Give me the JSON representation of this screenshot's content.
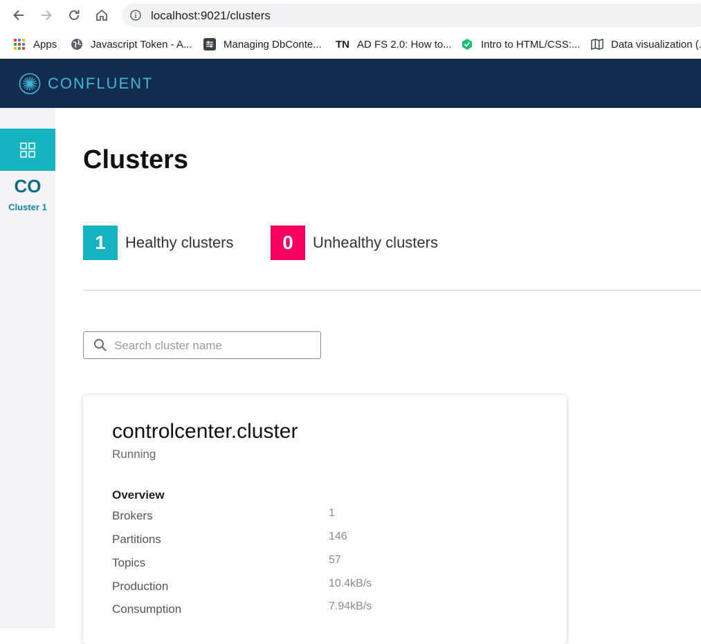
{
  "browser": {
    "url": "localhost:9021/clusters",
    "bookmarks": [
      {
        "label": "Apps",
        "icon": "apps-grid-icon"
      },
      {
        "label": "Javascript Token - A...",
        "icon": "globe-icon"
      },
      {
        "label": "Managing DbConte...",
        "icon": "settings-doc-icon"
      },
      {
        "label": "AD FS 2.0: How to...",
        "icon": "tn-icon",
        "icon_text": "TN"
      },
      {
        "label": "Intro to HTML/CSS:...",
        "icon": "hex-logo-icon"
      },
      {
        "label": "Data visualization (...",
        "icon": "book-icon"
      }
    ]
  },
  "header": {
    "brand": "CONFLUENT",
    "brand_color": "#3db9d2",
    "background": "#142b50"
  },
  "sidebar": {
    "cluster_abbr": "CO",
    "cluster_label": "Cluster 1",
    "accent": "#17b3c1"
  },
  "main": {
    "title": "Clusters",
    "healthy": {
      "count": "1",
      "label": "Healthy clusters",
      "color": "#17b3c1"
    },
    "unhealthy": {
      "count": "0",
      "label": "Unhealthy clusters",
      "color": "#f5005f"
    },
    "search": {
      "placeholder": "Search cluster name",
      "value": ""
    },
    "cluster": {
      "name": "controlcenter.cluster",
      "status": "Running",
      "overview_title": "Overview",
      "metrics": [
        {
          "label": "Brokers",
          "value": "1"
        },
        {
          "label": "Partitions",
          "value": "146"
        },
        {
          "label": "Topics",
          "value": "57"
        },
        {
          "label": "Production",
          "value": "10.4kB/s"
        },
        {
          "label": "Consumption",
          "value": "7.94kB/s"
        }
      ]
    }
  }
}
